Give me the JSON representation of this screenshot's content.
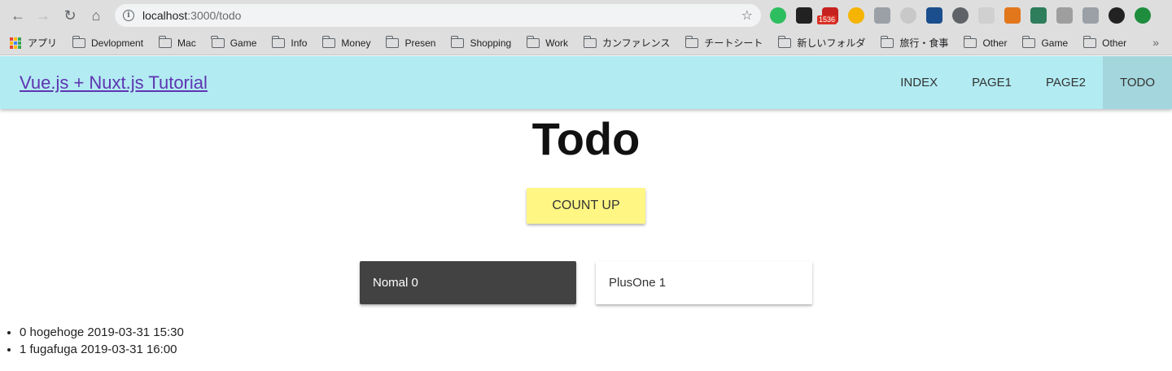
{
  "browser": {
    "url_host": "localhost",
    "url_path": ":3000/todo",
    "badge_count": "1536"
  },
  "bookmarks": [
    {
      "label": "アプリ",
      "type": "apps"
    },
    {
      "label": "Devlopment",
      "type": "folder"
    },
    {
      "label": "Mac",
      "type": "folder"
    },
    {
      "label": "Game",
      "type": "folder"
    },
    {
      "label": "Info",
      "type": "folder"
    },
    {
      "label": "Money",
      "type": "folder"
    },
    {
      "label": "Presen",
      "type": "folder"
    },
    {
      "label": "Shopping",
      "type": "folder"
    },
    {
      "label": "Work",
      "type": "folder"
    },
    {
      "label": "カンファレンス",
      "type": "folder"
    },
    {
      "label": "チートシート",
      "type": "folder"
    },
    {
      "label": "新しいフォルダ",
      "type": "folder"
    },
    {
      "label": "旅行・食事",
      "type": "folder"
    },
    {
      "label": "Other",
      "type": "folder"
    },
    {
      "label": "Game",
      "type": "folder"
    },
    {
      "label": "Other",
      "type": "folder"
    }
  ],
  "bookmarks_more": "»",
  "header": {
    "brand": "Vue.js + Nuxt.js Tutorial",
    "menu": [
      "INDEX",
      "PAGE1",
      "PAGE2",
      "TODO"
    ],
    "active": "TODO",
    "color": "#b2ebf2"
  },
  "page": {
    "title": "Todo",
    "count_button": "COUNT UP",
    "cards": {
      "normal": "Nomal 0",
      "plus_one": "PlusOne 1"
    },
    "todos": [
      "0 hogehoge 2019-03-31 15:30",
      "1 fugafuga 2019-03-31 16:00"
    ]
  },
  "colors": {
    "button": "#fff684",
    "dark_card": "#424242",
    "link": "#5e35b1"
  }
}
